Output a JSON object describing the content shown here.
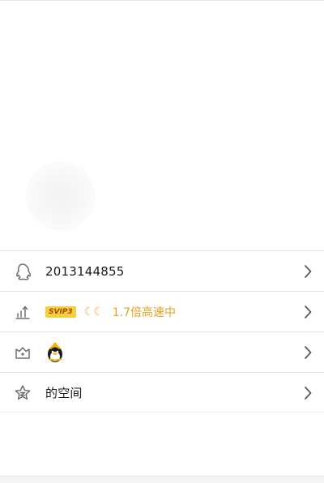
{
  "profile": {
    "qq_number": "2013144855",
    "svip_badge": "SVIP3",
    "level_moons": "☾☾",
    "speed_text": "1.7倍高速中",
    "space_label": "的空间"
  },
  "colors": {
    "accent_gold": "#e6a120",
    "badge_bg": "#f6cf3c",
    "divider": "#e2e2e2"
  },
  "icons": [
    "qq-penguin-icon",
    "level-rank-icon",
    "medal-icon",
    "star-space-icon",
    "chevron-right-icon",
    "penguin-avatar-icon"
  ]
}
